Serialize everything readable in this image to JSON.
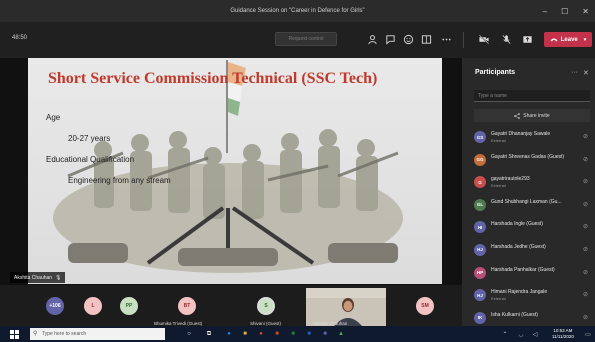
{
  "window": {
    "title": "Guidance Session on \"Career in Defence for Girls\"",
    "minimize": "–",
    "maximize": "☐",
    "close": "✕"
  },
  "toolbar": {
    "timer": "48:50",
    "request_control": "Request control",
    "leave_label": "Leave",
    "icons": [
      "participants-icon",
      "chat-icon",
      "reactions-icon",
      "rooms-icon",
      "more-icon",
      "camera-off-icon",
      "mic-off-icon",
      "share-icon"
    ]
  },
  "slide": {
    "title": "Short Service Commission Technical (SSC Tech)",
    "lines": [
      "Age",
      "20-27 years",
      "Educational Qualification",
      "Engineering from any stream"
    ]
  },
  "presenter": {
    "name": "Akshita Chauhan"
  },
  "participants_panel": {
    "title": "Participants",
    "search_placeholder": "Type a name",
    "share_invite": "Share invite",
    "people": [
      {
        "initials": "GS",
        "name": "Gayatri Dhananjay Sawale",
        "sub": "External",
        "color": "#6264a7"
      },
      {
        "initials": "GG",
        "name": "Gayatri Shreenas Gadas (Guest)",
        "sub": "",
        "color": "#c36d3a"
      },
      {
        "initials": "G",
        "name": "gayatrirautole293",
        "sub": "External",
        "color": "#c94f4f"
      },
      {
        "initials": "GL",
        "name": "Gund Shubhangi Laxman (Gu...",
        "sub": "",
        "color": "#4f7a4f"
      },
      {
        "initials": "HI",
        "name": "Harshada Ingle (Guest)",
        "sub": "",
        "color": "#6264a7"
      },
      {
        "initials": "HJ",
        "name": "Harshada Jedhe (Guest)",
        "sub": "",
        "color": "#6264a7"
      },
      {
        "initials": "HP",
        "name": "Harshada Panhalkar (Guest)",
        "sub": "",
        "color": "#b84f77"
      },
      {
        "initials": "HJ",
        "name": "Himani Rajendra Jangale",
        "sub": "External",
        "color": "#6264a7"
      },
      {
        "initials": "IK",
        "name": "Isha Kulkarni (Guest)",
        "sub": "",
        "color": "#6264a7"
      }
    ]
  },
  "strip": {
    "overflow_count": "+106",
    "avatars": [
      {
        "initials": "L",
        "bg": "#f3c2c2",
        "fg": "#9c2b2b"
      },
      {
        "initials": "PP",
        "bg": "#c9e1c2",
        "fg": "#2f6b2f"
      },
      {
        "initials": "BT",
        "bg": "#f3c2c2",
        "fg": "#9c2b2b",
        "label": "Bhumika Trivedi (Guest)"
      },
      {
        "initials": "S",
        "bg": "#c9e1c2",
        "fg": "#2f6b2f",
        "label": "Shivani (Guest)"
      },
      {
        "initials": "SM",
        "bg": "#f3c2c2",
        "fg": "#9c2b2b"
      }
    ],
    "video_label": "Akshita Chauhan"
  },
  "taskbar": {
    "search_placeholder": "Type here to search",
    "time": "10:53 AM",
    "date": "11/11/2020"
  }
}
